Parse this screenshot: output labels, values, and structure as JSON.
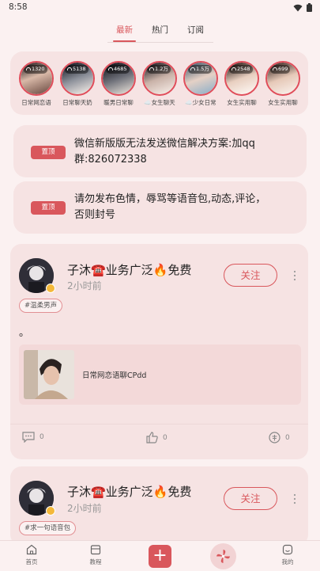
{
  "status": {
    "time": "8:58"
  },
  "tabs": [
    {
      "label": "最新",
      "active": true
    },
    {
      "label": "热门",
      "active": false
    },
    {
      "label": "订阅",
      "active": false
    }
  ],
  "streamers": [
    {
      "listeners": "1320",
      "name": "日常网恋语"
    },
    {
      "listeners": "5138",
      "name": "日常聊天奶"
    },
    {
      "listeners": "4685",
      "name": "暖男日常聊"
    },
    {
      "listeners": "1.2万",
      "name": "☁️女生聊天"
    },
    {
      "listeners": "1.5万",
      "name": "☁️少女日常"
    },
    {
      "listeners": "2548",
      "name": "女生实用聊"
    },
    {
      "listeners": "699",
      "name": "女生实用聊"
    }
  ],
  "notices": [
    {
      "badge": "置顶",
      "line1": "微信新版版无法发送微信解决方案:加qq",
      "line2": "群:826072338"
    },
    {
      "badge": "置顶",
      "line1": "请勿发布色情，辱骂等语音包,动态,评论，",
      "line2": "否则封号"
    }
  ],
  "posts": [
    {
      "name": "子沐☎️业务广泛🔥免费",
      "time": "2小时前",
      "follow_label": "关注",
      "tag": "#温柔男声",
      "text": "。",
      "voice_title": "日常网恋语聊CPdd",
      "comments": "0",
      "likes": "0",
      "gifts": "0"
    },
    {
      "name": "子沐☎️业务广泛🔥免费",
      "time": "2小时前",
      "follow_label": "关注",
      "tag": "#求一句语音包"
    }
  ],
  "bottom_nav": {
    "home": "首页",
    "tutorial": "教程",
    "add": "+",
    "mine": "我的"
  },
  "colors": {
    "accent": "#d9575c",
    "background": "#fbf1f1",
    "card": "#f6e3e3"
  }
}
